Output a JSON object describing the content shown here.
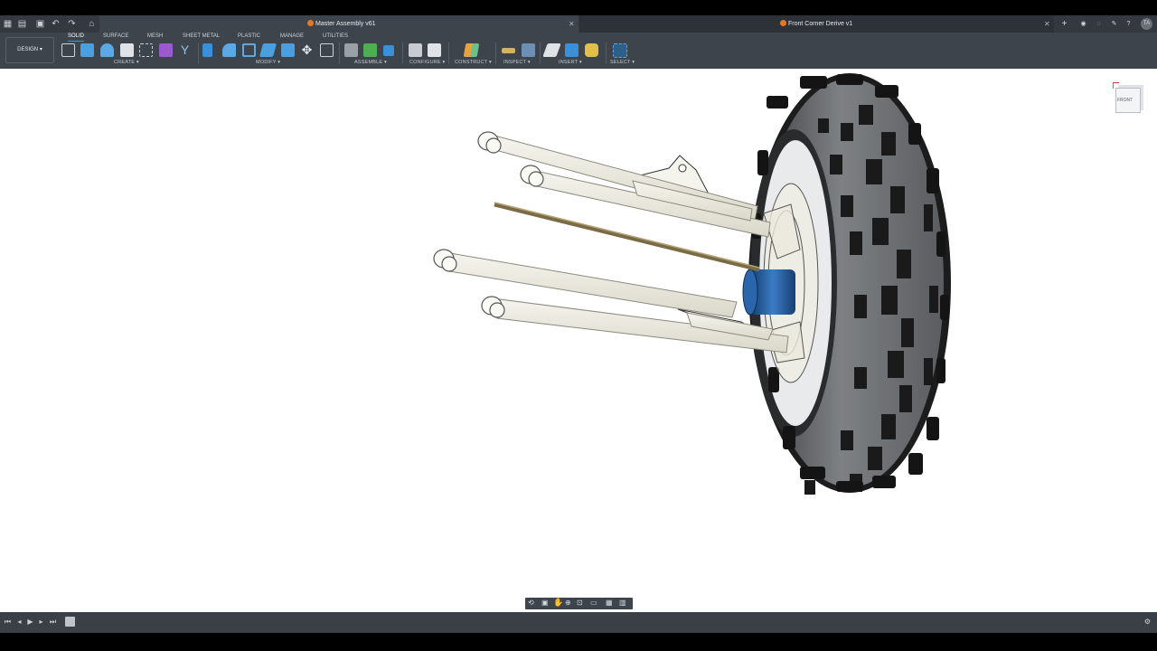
{
  "tabs": [
    {
      "label": "Master Assembly v61",
      "active": true
    },
    {
      "label": "Front Corner Derive v1",
      "active": false
    }
  ],
  "workspace_button": {
    "label": "DESIGN",
    "icon": "chevron-down-icon"
  },
  "workspace_tabs": [
    "SOLID",
    "SURFACE",
    "MESH",
    "SHEET METAL",
    "PLASTIC",
    "MANAGE",
    "UTILITIES"
  ],
  "active_workspace_tab": "SOLID",
  "tool_groups": [
    "CREATE",
    "MODIFY",
    "ASSEMBLE",
    "CONFIGURE",
    "CONSTRUCT",
    "INSPECT",
    "INSERT",
    "SELECT"
  ],
  "viewcube": {
    "label": "FRONT"
  },
  "user": {
    "initials": "TA"
  },
  "colors": {
    "accent": "#2d9cdb",
    "toolbar_bg": "#3d444b",
    "tab_bar_bg": "#33393f",
    "canvas_bg": "#ffffff",
    "tire": "#6f7275",
    "motor": "#1f5a9e",
    "tube": "#efeee4"
  }
}
